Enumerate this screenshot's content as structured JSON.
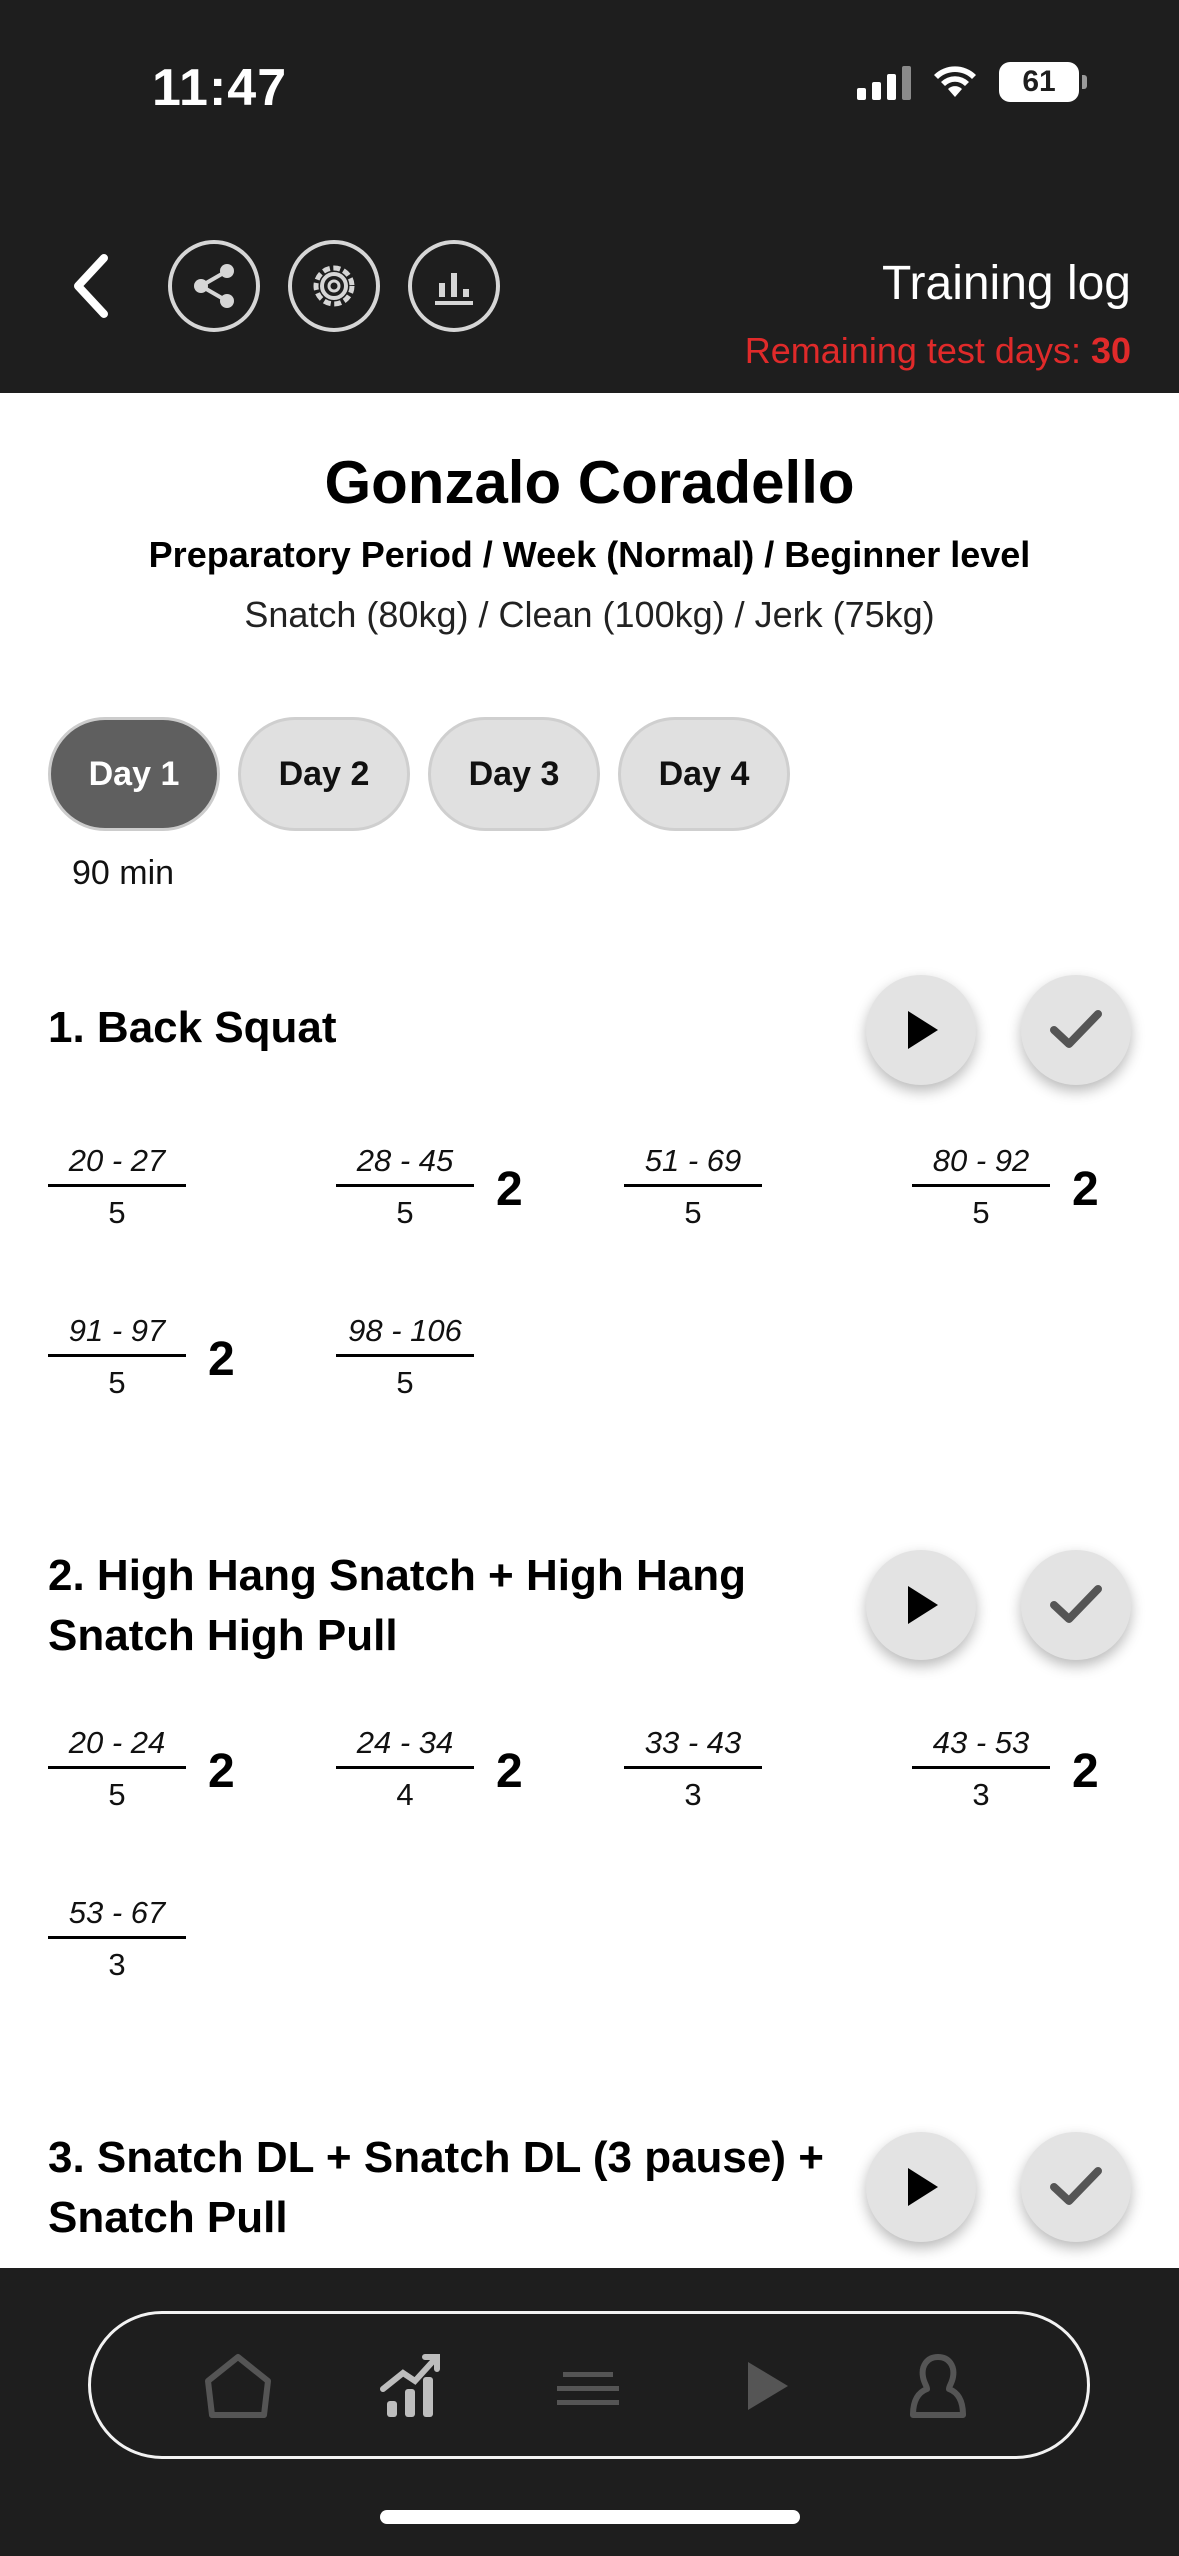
{
  "status_bar": {
    "time": "11:47",
    "battery": "61"
  },
  "header": {
    "title": "Training log",
    "remaining_label": "Remaining test days: ",
    "remaining_value": "30"
  },
  "icons": {
    "back": "chevron-left-icon",
    "share": "share-icon",
    "settings": "gear-icon",
    "stats": "chart-icon",
    "play": "play-icon",
    "done": "check-icon"
  },
  "athlete": {
    "name": "Gonzalo Coradello",
    "period": "Preparatory Period / Week (Normal) / Beginner level",
    "maxes": "Snatch (80kg) / Clean (100kg) / Jerk (75kg)"
  },
  "days": [
    {
      "label": "Day 1",
      "active": true
    },
    {
      "label": "Day 2",
      "active": false
    },
    {
      "label": "Day 3",
      "active": false
    },
    {
      "label": "Day 4",
      "active": false
    }
  ],
  "duration": "90 min",
  "exercises": [
    {
      "title": "1. Back Squat",
      "sets": [
        {
          "load": "20 - 27",
          "reps": "5",
          "count": ""
        },
        {
          "load": "28 - 45",
          "reps": "5",
          "count": "2"
        },
        {
          "load": "51 - 69",
          "reps": "5",
          "count": ""
        },
        {
          "load": "80 - 92",
          "reps": "5",
          "count": "2"
        },
        {
          "load": "91 - 97",
          "reps": "5",
          "count": "2"
        },
        {
          "load": "98 - 106",
          "reps": "5",
          "count": ""
        }
      ]
    },
    {
      "title": "2. High Hang Snatch + High Hang Snatch High Pull",
      "sets": [
        {
          "load": "20 - 24",
          "reps": "5",
          "count": "2"
        },
        {
          "load": "24 - 34",
          "reps": "4",
          "count": "2"
        },
        {
          "load": "33 - 43",
          "reps": "3",
          "count": ""
        },
        {
          "load": "43 - 53",
          "reps": "3",
          "count": "2"
        },
        {
          "load": "53 - 67",
          "reps": "3",
          "count": ""
        }
      ]
    },
    {
      "title": "3. Snatch DL + Snatch DL (3 pause) + Snatch Pull",
      "sets": []
    }
  ],
  "bottom_nav": [
    {
      "name": "home-icon"
    },
    {
      "name": "progress-chart-icon",
      "active": true
    },
    {
      "name": "list-icon"
    },
    {
      "name": "play-icon"
    },
    {
      "name": "profile-icon"
    }
  ]
}
